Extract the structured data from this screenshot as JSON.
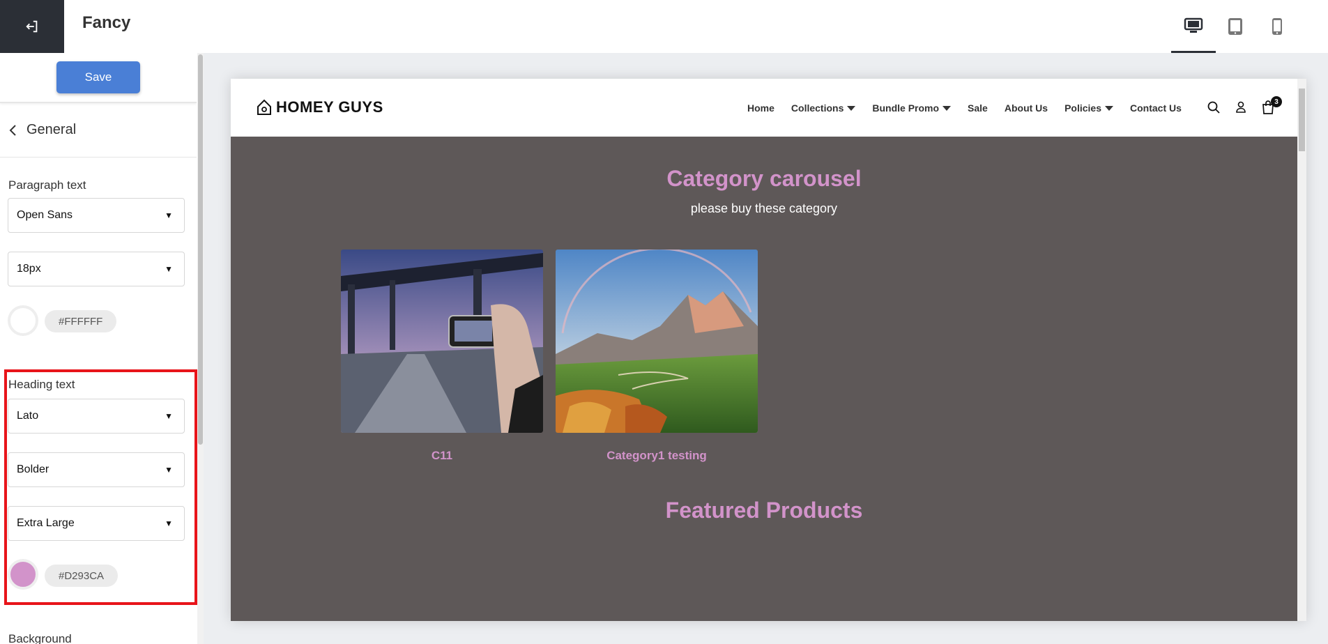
{
  "app": {
    "title": "Fancy"
  },
  "toolbar": {
    "save_label": "Save"
  },
  "section": {
    "title": "General"
  },
  "paragraph": {
    "label": "Paragraph text",
    "font": "Open Sans",
    "size": "18px",
    "color_hex": "#FFFFFF"
  },
  "heading": {
    "label": "Heading text",
    "font": "Lato",
    "weight": "Bolder",
    "size": "Extra Large",
    "color_hex": "#D293CA"
  },
  "background": {
    "label": "Background"
  },
  "colors": {
    "accent": "#d293ca",
    "save": "#4a7fd6",
    "highlight": "#e8141a",
    "body_bg": "#5e5858"
  },
  "site": {
    "logo_text": "HOMEY GUYS",
    "nav": [
      "Home",
      "Collections",
      "Bundle Promo",
      "Sale",
      "About Us",
      "Policies",
      "Contact Us"
    ],
    "cart_count": "3",
    "carousel_title": "Category carousel",
    "carousel_subtitle": "please buy these category",
    "categories": [
      "C11",
      "Category1 testing"
    ],
    "featured_title": "Featured Products"
  }
}
